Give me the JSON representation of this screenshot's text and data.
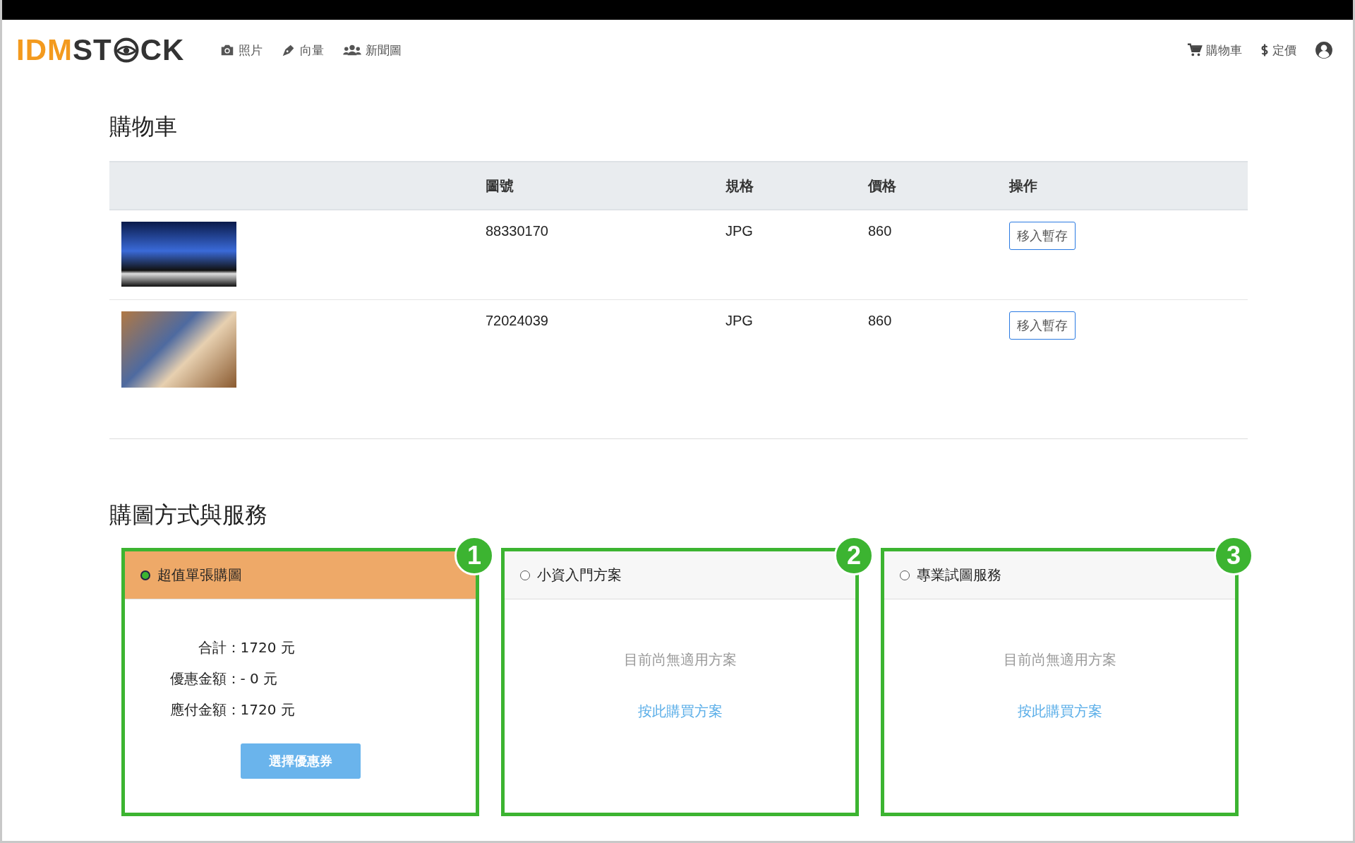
{
  "header": {
    "logo": {
      "prefix": "IDM",
      "middle": "ST",
      "suffix": "CK"
    },
    "nav": [
      {
        "label": "照片"
      },
      {
        "label": "向量"
      },
      {
        "label": "新聞圖"
      }
    ],
    "right_nav": [
      {
        "label": "購物車"
      },
      {
        "label": "定價"
      }
    ]
  },
  "cart": {
    "title": "購物車",
    "columns": [
      "圖號",
      "規格",
      "價格",
      "操作"
    ],
    "rows": [
      {
        "id": "88330170",
        "format": "JPG",
        "price": "860",
        "action": "移入暫存"
      },
      {
        "id": "72024039",
        "format": "JPG",
        "price": "860",
        "action": "移入暫存"
      }
    ]
  },
  "services": {
    "title": "購圖方式與服務",
    "options": [
      {
        "kind": "summary",
        "label": "超值單張購圖",
        "selected": true,
        "badge": "1",
        "lines": [
          {
            "label": "合計：",
            "value": "1720 元"
          },
          {
            "label": "優惠金額：",
            "value": "- 0 元"
          },
          {
            "label": "應付金額：",
            "value": "1720 元"
          }
        ],
        "button": "選擇優惠券"
      },
      {
        "kind": "empty",
        "label": "小資入門方案",
        "selected": false,
        "badge": "2",
        "message": "目前尚無適用方案",
        "link": "按此購買方案"
      },
      {
        "kind": "empty",
        "label": "專業試圖服務",
        "selected": false,
        "badge": "3",
        "message": "目前尚無適用方案",
        "link": "按此購買方案"
      }
    ]
  }
}
